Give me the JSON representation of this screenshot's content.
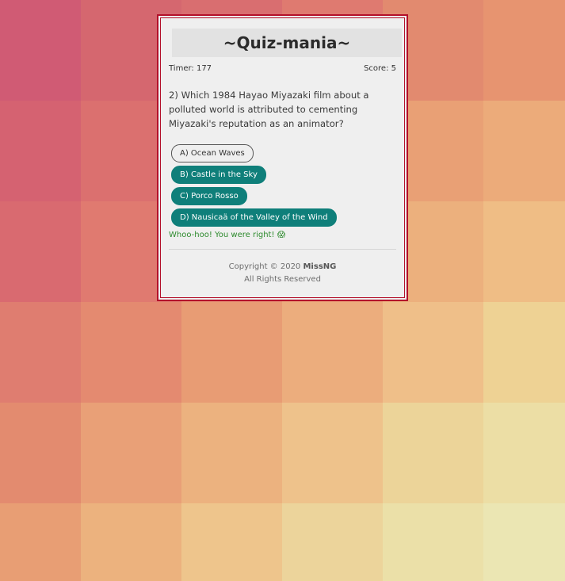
{
  "app": {
    "title": "~Quiz-mania~"
  },
  "status": {
    "timer_text": "Timer: 177",
    "score_text": "Score: 5"
  },
  "question": {
    "text": "2) Which 1984 Hayao Miyazaki film about a polluted world is attributed to cementing Miyazaki's reputation as an animator?"
  },
  "answers": [
    {
      "label": "A) Ocean Waves",
      "style": "outlined"
    },
    {
      "label": "B) Castle in the Sky",
      "style": "filled"
    },
    {
      "label": "C) Porco Rosso",
      "style": "filled"
    },
    {
      "label": "D) Nausicaä of the Valley of the Wind",
      "style": "filled"
    }
  ],
  "feedback": {
    "text": "Whoo-hoo! You were right!",
    "emoji": "😱",
    "color": "#2e8b2e"
  },
  "footer": {
    "line1_prefix": "Copyright © 2020",
    "author": "MissNG",
    "line2": "All Rights Reserved"
  },
  "colors": {
    "accent_teal": "#0f7f7a",
    "border_red": "#b3102a",
    "card_bg": "#efefef"
  }
}
